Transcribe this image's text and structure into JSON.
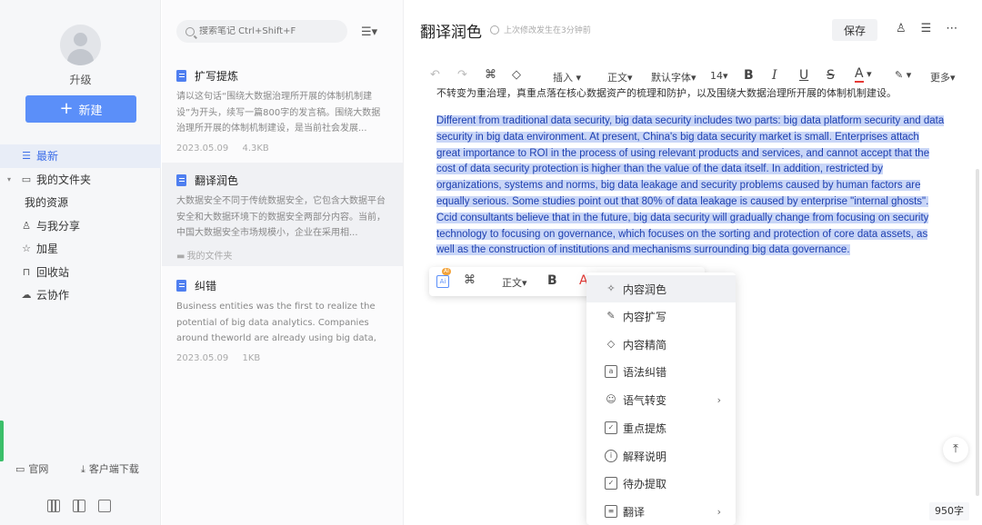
{
  "sidebar": {
    "upgrade_label": "升级",
    "new_button": "新建",
    "items": [
      {
        "label": "最新",
        "icon": "list-icon",
        "active": true
      },
      {
        "label": "我的文件夹",
        "icon": "folder-icon"
      },
      {
        "label": "我的资源",
        "sub": true
      },
      {
        "label": "与我分享",
        "icon": "share-icon"
      },
      {
        "label": "加星",
        "icon": "star-icon"
      },
      {
        "label": "回收站",
        "icon": "trash-icon"
      },
      {
        "label": "云协作",
        "icon": "cloud-icon"
      }
    ],
    "bottom": {
      "website": "官网",
      "download": "客户端下载"
    },
    "accent": "#5b8ff9"
  },
  "notes": {
    "search_placeholder": "搜索笔记 Ctrl+Shift+F",
    "items": [
      {
        "title": "扩写提炼",
        "excerpt": "请以这句话“围绕大数据治理所开展的体制机制建设”为开头，续写一篇800字的发言稿。围绕大数据治理所开展的体制机制建设，是当前社会发展...",
        "date": "2023.05.09",
        "size": "4.3KB"
      },
      {
        "title": "翻译润色",
        "excerpt": "大数据安全不同于传统数据安全，它包含大数据平台安全和大数据环境下的数据安全两部分内容。当前，中国大数据安全市场规模小，企业在采用相...",
        "folder": "我的文件夹"
      },
      {
        "title": "纠错",
        "excerpt": "Business entities was the first to realize the potential of big data analytics. Companies around theworld are already using big data, s...",
        "date": "2023.05.09",
        "size": "1KB"
      }
    ]
  },
  "editor": {
    "title": "翻译润色",
    "save_status": "上次修改发生在3分钟前",
    "save_button": "保存",
    "toolbar": {
      "insert": "插入",
      "style": "正文",
      "font": "默认字体",
      "size": "14",
      "bold": "B",
      "italic": "I",
      "underline": "U",
      "strike": "S",
      "color": "A",
      "more": "更多"
    },
    "cut_line": "不转变为重治理，真重点落在核心数据资产的梳理和防护，以及围绕大数据治理所开展的体制机制建设。",
    "selected_text": "Different from traditional data security, big data security includes two parts: big data platform security and data security in big data environment. At present, China's big data security market is small. Enterprises attach great importance to ROI in the process of using relevant products and services, and cannot accept that the cost of data security protection is higher than the value of the data itself. In addition, restricted by organizations, systems and norms, big data leakage and security problems caused by human factors are equally serious. Some studies point out that 80% of data leakage is caused by enterprise \"internal ghosts\". Ccid consultants believe that in the future, big data security will gradually change from focusing on security technology to focusing on governance, which focuses on the sorting and protection of core data assets, as well as the construction of institutions and mechanisms surrounding big data governance.",
    "float_bar": {
      "ai_label": "Ai",
      "ai_tag": "AI",
      "style": "正文",
      "bold": "B"
    },
    "menu": [
      {
        "label": "内容润色",
        "icon": "sparkle-icon",
        "active": true
      },
      {
        "label": "内容扩写",
        "icon": "pen-icon"
      },
      {
        "label": "内容精简",
        "icon": "eraser-icon"
      },
      {
        "label": "语法纠错",
        "icon": "grammar-icon"
      },
      {
        "label": "语气转变",
        "icon": "smile-icon",
        "submenu": true
      },
      {
        "label": "重点提炼",
        "icon": "extract-icon"
      },
      {
        "label": "解释说明",
        "icon": "info-icon"
      },
      {
        "label": "待办提取",
        "icon": "todo-icon"
      },
      {
        "label": "翻译",
        "icon": "translate-icon",
        "submenu": true
      }
    ],
    "word_count": "950字"
  }
}
